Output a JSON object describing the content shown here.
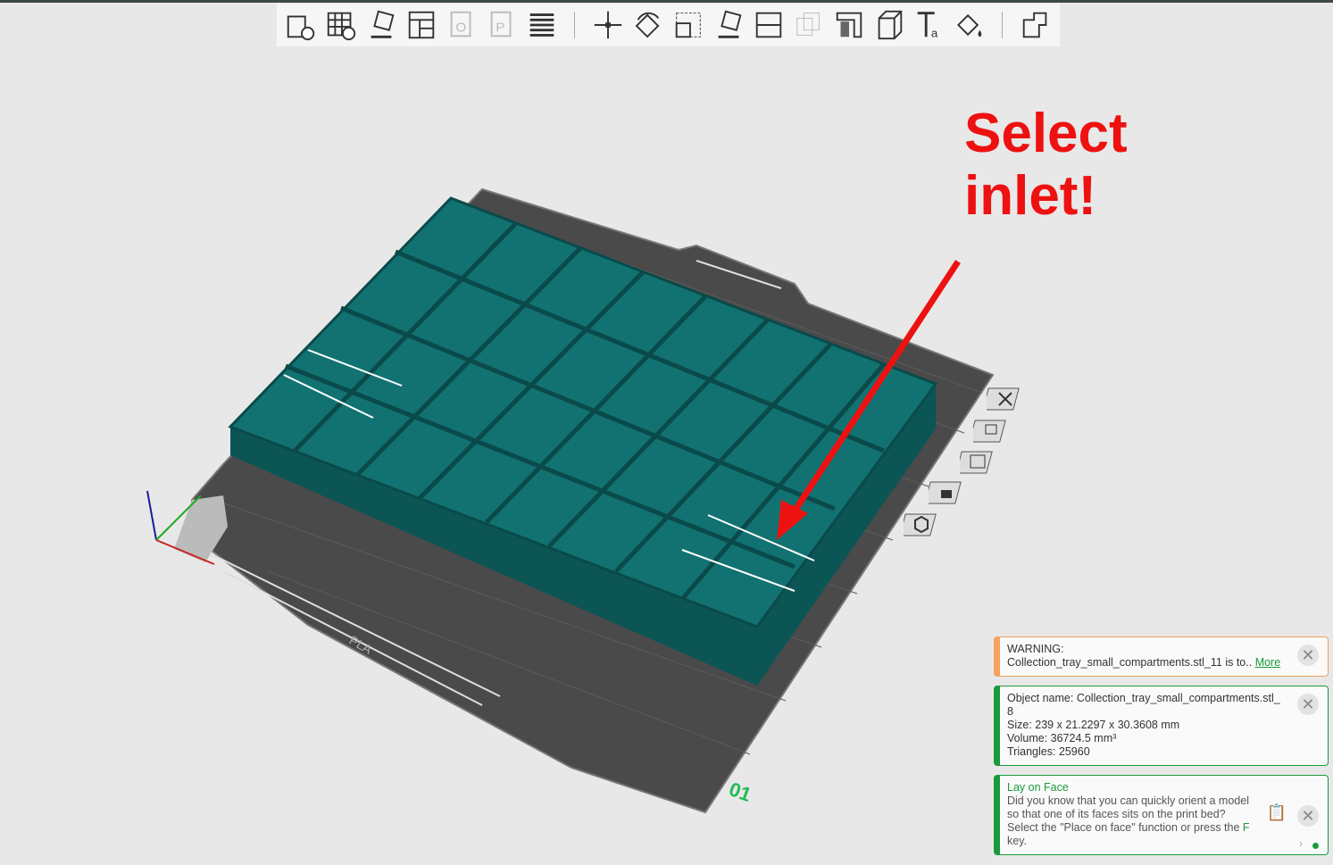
{
  "toolbar": {
    "items": [
      {
        "name": "add-object",
        "enabled": true
      },
      {
        "name": "add-plate",
        "enabled": true
      },
      {
        "name": "auto-orient",
        "enabled": true
      },
      {
        "name": "arrange",
        "enabled": true
      },
      {
        "name": "copy",
        "enabled": false
      },
      {
        "name": "paste",
        "enabled": false
      },
      {
        "name": "layers",
        "enabled": true
      },
      {
        "name": "move",
        "enabled": true
      },
      {
        "name": "rotate",
        "enabled": true
      },
      {
        "name": "scale",
        "enabled": true
      },
      {
        "name": "lay-on-face",
        "enabled": true
      },
      {
        "name": "cut",
        "enabled": true
      },
      {
        "name": "boolean",
        "enabled": false
      },
      {
        "name": "support-paint",
        "enabled": true
      },
      {
        "name": "seam-paint",
        "enabled": true
      },
      {
        "name": "text",
        "enabled": true
      },
      {
        "name": "color-paint",
        "enabled": true
      },
      {
        "name": "assembly",
        "enabled": true
      }
    ]
  },
  "annotation": {
    "line1": "Select",
    "line2": "inlet!",
    "color": "#ee1111"
  },
  "bed": {
    "plate_number": "01",
    "label": "PLA"
  },
  "model_color": "#0f6b6b",
  "notifications": {
    "warning": {
      "title": "WARNING:",
      "text": "Collection_tray_small_compartments.stl_11 is to..",
      "link": "More"
    },
    "info": {
      "name": "Object name: Collection_tray_small_compartments.stl_",
      "name_cont": "8",
      "size": "Size: 239 x 21.2297 x 30.3608 mm",
      "volume": "Volume: 36724.5 mm³",
      "triangles": "Triangles: 25960"
    },
    "tip": {
      "title": "Lay on Face",
      "text_before": "Did you know that you can quickly orient a model so that one of its faces sits on the print bed? Select the \"Place on face\" function or press the ",
      "key": "F",
      "text_after": " key."
    }
  }
}
